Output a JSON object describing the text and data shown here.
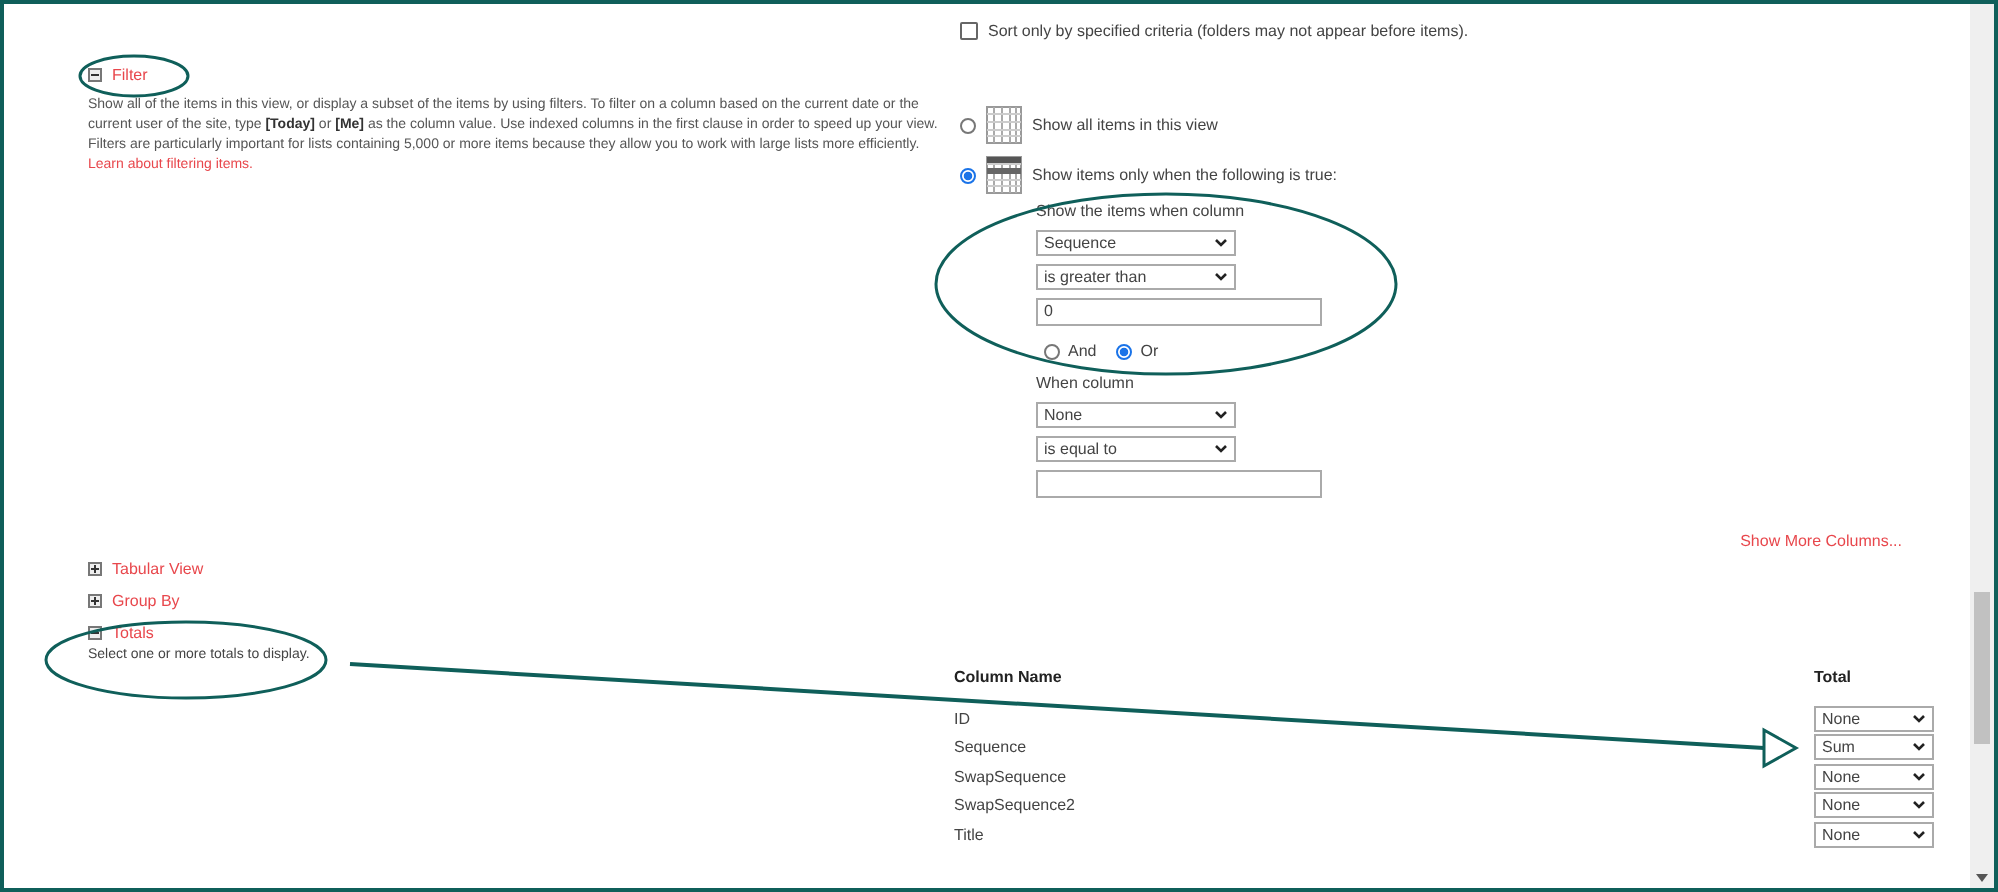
{
  "sort_option": {
    "label": "Sort only by specified criteria (folders may not appear before items).",
    "checked": false
  },
  "filter_section": {
    "title": "Filter",
    "expanded": true,
    "description": "Show all of the items in this view, or display a subset of the items by using filters. To filter on a column based on the current date or the current user of the site, type **[Today]** or **[Me]** as the column value. Use indexed columns in the first clause in order to speed up your view. Filters are particularly important for lists containing 5,000 or more items because they allow you to work with large lists more efficiently.",
    "link": "Learn about filtering items."
  },
  "filter_options": [
    {
      "label": "Show all items in this view",
      "selected": false
    },
    {
      "label": "Show items only when the following is true:",
      "selected": true
    }
  ],
  "conditions": [
    {
      "label": "Show the items when column",
      "column": "Sequence",
      "operator": "is greater than",
      "value": "0",
      "joiners": [
        {
          "label": "And",
          "selected": false
        },
        {
          "label": "Or",
          "selected": true
        }
      ]
    },
    {
      "label": "When column",
      "column": "None",
      "operator": "is equal to"
    }
  ],
  "show_more_columns": "Show More Columns...",
  "collapsed_sections": [
    {
      "title": "Tabular View",
      "expanded": false
    },
    {
      "title": "Group By",
      "expanded": false
    }
  ],
  "totals_section": {
    "title": "Totals",
    "expanded": true,
    "description": "Select one or more totals to display."
  },
  "totals_table": {
    "columns": [
      "Column Name",
      "Total"
    ],
    "rows": [
      {
        "name": "ID",
        "total": "None"
      },
      {
        "name": "Sequence",
        "total": "Sum"
      },
      {
        "name": "SwapSequence",
        "total": "None"
      },
      {
        "name": "SwapSequence2",
        "total": "None"
      },
      {
        "name": "Title",
        "total": "None"
      }
    ]
  }
}
